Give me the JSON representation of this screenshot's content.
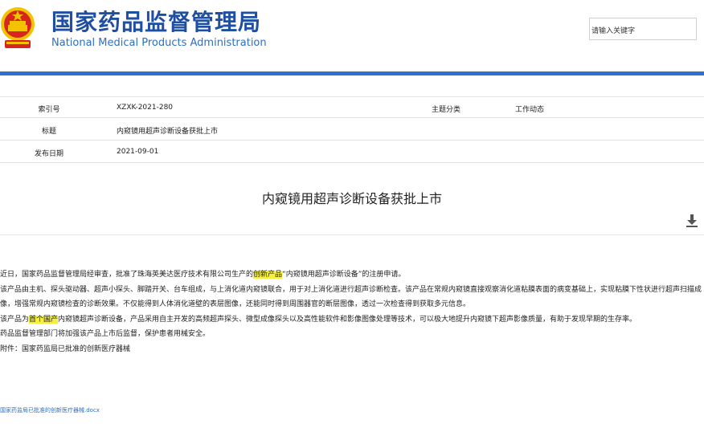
{
  "header": {
    "title_cn": "国家药品监督管理局",
    "title_en": "National Medical Products Administration",
    "search_placeholder": "请输入关键字"
  },
  "meta": {
    "index_label": "索引号",
    "index_value": "XZXK-2021-280",
    "category_label": "主题分类",
    "category_value": "工作动态",
    "title_label": "标题",
    "title_value": "内窥镜用超声诊断设备获批上市",
    "date_label": "发布日期",
    "date_value": "2021-09-01"
  },
  "article": {
    "title": "内窥镜用超声诊断设备获批上市",
    "p1_a": "近日，国家药品监督管理局经审查，批准了珠海英美达医疗技术有限公司生产的",
    "p1_hl": "创新产品",
    "p1_b": "“内窥镜用超声诊断设备”的注册申请。",
    "p2": "该产品由主机、探头驱动器、超声小探头、脚踏开关、台车组成，与上消化道内窥镜联合，用于对上消化道进行超声诊断检查。该产品在常规内窥镜直接观察消化道粘膜表面的病变基础上，实现粘膜下性状进行超声扫描成像，增强常规内窥镜检查的诊断效果。不仅能得到人体消化道壁的表层图像，还能同时得到周围器官的断层图像，透过一次检查得到获取多元信息。",
    "p3_a": "该产品为",
    "p3_hl": "首个国产",
    "p3_b": "内窥镜超声诊断设备，产品采用自主开发的高频超声探头、微型成像探头以及高性能软件和影像图像处理等技术，可以极大地提升内窥镜下超声影像质量，有助于发现早期的生存率。",
    "p4": "药品监督管理部门将加强该产品上市后监督，保护患者用械安全。",
    "p5": "附件：国家药监局已批准的创新医疗器械",
    "attachment": "国家药监局已批准的创新医疗器械.docx"
  },
  "colors": {
    "brand_blue": "#1f4fa3",
    "bar_blue": "#2f6fd0",
    "highlight": "#f5f03a",
    "emblem_red": "#d6261d",
    "emblem_gold": "#f3c300"
  }
}
